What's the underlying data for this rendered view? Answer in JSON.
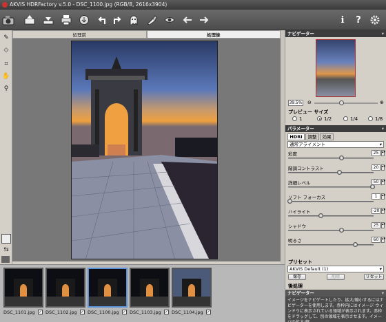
{
  "window": {
    "title": "AKVIS HDRFactory v.5.0 - DSC_1100.jpg (RGB/8, 2616x3904)"
  },
  "toolbar": {
    "items": [
      "camera-icon",
      "open-icon",
      "save-icon",
      "print-icon",
      "share-icon",
      "undo-icon",
      "redo-icon",
      "ghost-icon",
      "brush-icon",
      "eye-icon",
      "back-icon",
      "forward-icon",
      "info-icon",
      "help-icon",
      "settings-icon"
    ]
  },
  "view_tabs": {
    "before": "処理前",
    "after": "処理後"
  },
  "navigator": {
    "title": "ナビゲーター",
    "zoom": "39.5%"
  },
  "preview_size": {
    "title": "プレビュー サイズ",
    "options": [
      "1",
      "1/2",
      "1/4",
      "1/8"
    ],
    "selected": "1/2"
  },
  "params": {
    "title": "パラメーター",
    "tabs": [
      "HDRI",
      "調整",
      "効果"
    ],
    "active_tab": "HDRI",
    "preset_mode": "通常アライメント",
    "sliders": [
      {
        "label": "彩度",
        "value": "25",
        "level": 0.62
      },
      {
        "label": "階調コントラスト",
        "value": "20",
        "level": 0.6
      },
      {
        "label": "詳細レベル",
        "value": "50",
        "level": 0.98
      },
      {
        "label": "ソフト フォーカス",
        "value": "1",
        "level": 0.02
      },
      {
        "label": "ハイライト",
        "value": "-20",
        "level": 0.38
      },
      {
        "label": "シャドウ",
        "value": "25",
        "level": 0.62
      },
      {
        "label": "明るさ",
        "value": "60",
        "level": 0.78
      }
    ]
  },
  "presets": {
    "title": "プリセット",
    "selected": "AKVIS Default (1)",
    "save": "保存",
    "delete": "削除",
    "reset": "リセット"
  },
  "postproc": {
    "title": "後処理"
  },
  "help": {
    "title": "ナビゲーター",
    "text": "イメージをナビゲートしたり、拡大/縮小するにはナビゲーターを使用します。赤枠内にはイメージ ウィンドウに表示されている領域が表示されます。赤枠をドラッグして、別の領域を表示させます。イメージの拡大/縮"
  },
  "filmstrip": {
    "items": [
      "DSC_1101.jpg",
      "DSC_1102.jpg",
      "DSC_1100.jpg",
      "DSC_1103.jpg",
      "DSC_1104.jpg"
    ],
    "selected": 2
  }
}
